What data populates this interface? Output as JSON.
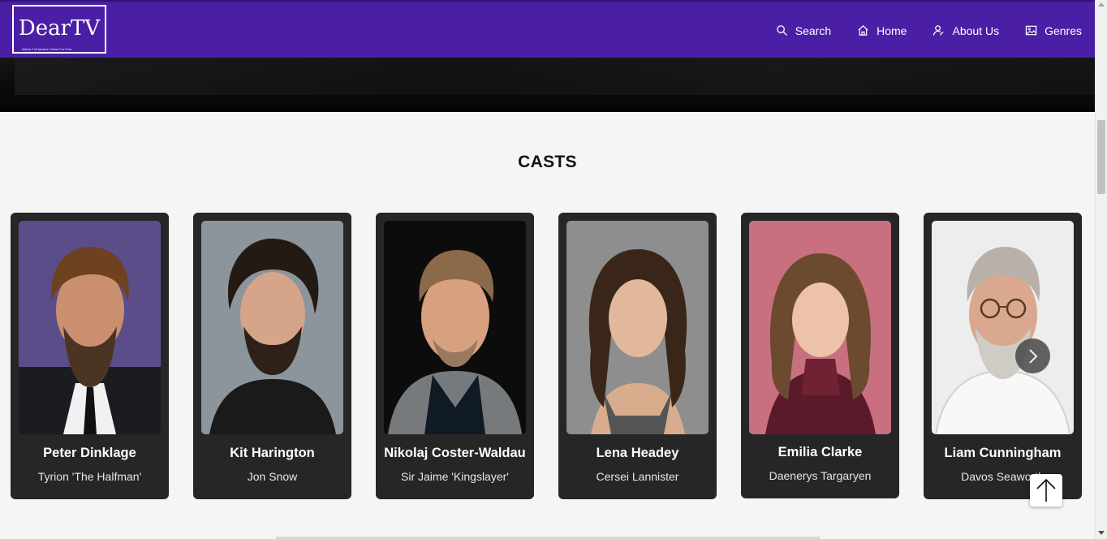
{
  "header": {
    "logo_text": "DearTV",
    "logo_tagline": "Watch Full Movies Online For Free",
    "nav": [
      {
        "label": "Search",
        "icon": "search-icon"
      },
      {
        "label": "Home",
        "icon": "home-icon"
      },
      {
        "label": "About Us",
        "icon": "user-icon"
      },
      {
        "label": "Genres",
        "icon": "image-icon"
      }
    ]
  },
  "section": {
    "title": "CASTS"
  },
  "casts": [
    {
      "name": "Peter Dinklage",
      "role": "Tyrion 'The Halfman'"
    },
    {
      "name": "Kit Harington",
      "role": "Jon Snow"
    },
    {
      "name": "Nikolaj Coster-Waldau",
      "role": "Sir Jaime 'Kingslayer'"
    },
    {
      "name": "Lena Headey",
      "role": "Cersei Lannister"
    },
    {
      "name": "Emilia Clarke",
      "role": "Daenerys Targaryen"
    },
    {
      "name": "Liam Cunningham",
      "role": "Davos Seaworth"
    }
  ],
  "colors": {
    "navbar": "#4a1fa6",
    "card": "#262626",
    "page_background": "#f5f5f5"
  }
}
